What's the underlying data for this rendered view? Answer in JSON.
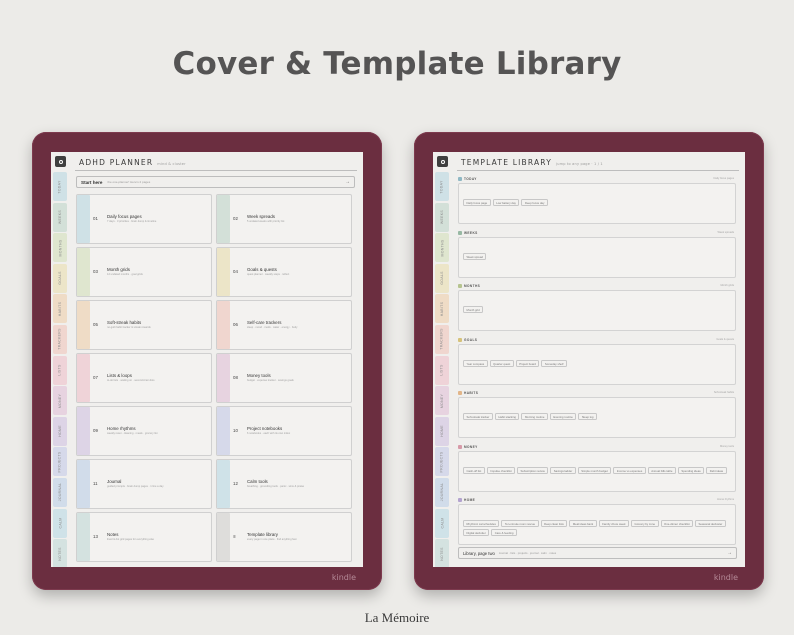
{
  "headline": "Cover & Template Library",
  "brand": "La Mémoire",
  "device_label": "kindle",
  "colors": {
    "device_frame": "#6b2e40",
    "screen": "#f0efed",
    "headline": "#555454"
  },
  "left_screen": {
    "title": "ADHD PLANNER",
    "subtitle": "mind & cluster",
    "start_label": "Start here",
    "start_hint": "the one-planner! Here's 2 pages",
    "start_arrow": "→",
    "sidebar_tabs": [
      {
        "label": "TODAY",
        "color": "#cfe1e6"
      },
      {
        "label": "WEEKS",
        "color": "#d3e0d8"
      },
      {
        "label": "MONTHS",
        "color": "#dfe6cf"
      },
      {
        "label": "GOALS",
        "color": "#ece5c8"
      },
      {
        "label": "HABITS",
        "color": "#efdcc6"
      },
      {
        "label": "TRACKERS",
        "color": "#f0d6cf"
      },
      {
        "label": "LISTS",
        "color": "#efd3d8"
      },
      {
        "label": "MONEY",
        "color": "#e7d3e0"
      },
      {
        "label": "HOME",
        "color": "#ddd4e6"
      },
      {
        "label": "PROJECTS",
        "color": "#d6d9ea"
      },
      {
        "label": "JOURNAL",
        "color": "#d1dcea"
      },
      {
        "label": "CALM",
        "color": "#cfe2e8"
      },
      {
        "label": "NOTES",
        "color": "#d4e2e0"
      }
    ],
    "cards": [
      {
        "num": "01",
        "title": "Daily focus pages",
        "desc": "7 days · 3 priorities · brain dump & timeline",
        "color": "#cfe1e6"
      },
      {
        "num": "02",
        "title": "Week spreads",
        "desc": "5 undated weeks with priority list",
        "color": "#d3e0d8"
      },
      {
        "num": "03",
        "title": "Month grids",
        "desc": "12 undated months · goal grids",
        "color": "#dfe6cf"
      },
      {
        "num": "04",
        "title": "Goals & quests",
        "desc": "quest planner · weekly steps · reflect",
        "color": "#ece5c8"
      },
      {
        "num": "05",
        "title": "Soft-streak habits",
        "desc": "no-guilt habit tracker & streak rewards",
        "color": "#efdcc6"
      },
      {
        "num": "06",
        "title": "Self-care trackers",
        "desc": "sleep · mood · meds · water · energy · body",
        "color": "#f0d6cf"
      },
      {
        "num": "07",
        "title": "Lists & loops",
        "desc": "to-do lists · waiting on · second-brain lists",
        "color": "#efd3d8"
      },
      {
        "num": "08",
        "title": "Money tools",
        "desc": "budget · expense tracker · savings goals",
        "color": "#e7d3e0"
      },
      {
        "num": "09",
        "title": "Home rhythms",
        "desc": "weekly reset · cleaning · meals · grocery list",
        "color": "#ddd4e6"
      },
      {
        "num": "10",
        "title": "Project notebooks",
        "desc": "6 notebooks · each with its own index",
        "color": "#d6d9ea"
      },
      {
        "num": "11",
        "title": "Journal",
        "desc": "guided prompts · brain dump pages · 1 line a day",
        "color": "#d1dcea"
      },
      {
        "num": "12",
        "title": "Calm tools",
        "desc": "breathing · grounding tools · panic · wins & praise",
        "color": "#cfe2e8"
      },
      {
        "num": "13",
        "title": "Notes",
        "desc": "lined & dot grid pages for everything else",
        "color": "#d4e2e0"
      },
      {
        "num": "≡",
        "title": "Template library",
        "desc": "every page in one place · find anything fast",
        "color": "#dedddb"
      }
    ]
  },
  "right_screen": {
    "title": "TEMPLATE LIBRARY",
    "subtitle": "jump to any page · 1 / 1",
    "sidebar_tabs": [
      {
        "label": "TODAY",
        "color": "#cfe1e6"
      },
      {
        "label": "WEEKS",
        "color": "#d3e0d8"
      },
      {
        "label": "MONTHS",
        "color": "#dfe6cf"
      },
      {
        "label": "GOALS",
        "color": "#ece5c8"
      },
      {
        "label": "HABITS",
        "color": "#efdcc6"
      },
      {
        "label": "TRACKERS",
        "color": "#f0d6cf"
      },
      {
        "label": "LISTS",
        "color": "#efd3d8"
      },
      {
        "label": "MONEY",
        "color": "#e7d3e0"
      },
      {
        "label": "HOME",
        "color": "#ddd4e6"
      },
      {
        "label": "PROJECTS",
        "color": "#d6d9ea"
      },
      {
        "label": "JOURNAL",
        "color": "#d1dcea"
      },
      {
        "label": "CALM",
        "color": "#cfe2e8"
      },
      {
        "label": "NOTES",
        "color": "#d4e2e0"
      }
    ],
    "sections": [
      {
        "name": "TODAY",
        "meta": "Daily focus pages",
        "color": "#8fb8c4",
        "chips": [
          "Daily focus page",
          "Low battery day",
          "Deep focus day"
        ]
      },
      {
        "name": "WEEKS",
        "meta": "Week spreads",
        "color": "#97b8a3",
        "chips": [
          "Week spread"
        ]
      },
      {
        "name": "MONTHS",
        "meta": "Month grids",
        "color": "#b6c48f",
        "chips": [
          "Month grid"
        ]
      },
      {
        "name": "GOALS",
        "meta": "Goals & quests",
        "color": "#d6c27a",
        "chips": [
          "Year compass",
          "Quarter quest",
          "Project board",
          "Someday shelf"
        ]
      },
      {
        "name": "HABITS",
        "meta": "Soft-streak habits",
        "color": "#e2b588",
        "chips": [
          "Soft-streak tracker",
          "Habit stacking",
          "Morning routine",
          "Evening routine",
          "Sleep log"
        ]
      },
      {
        "name": "MONEY",
        "meta": "Money tools",
        "color": "#d79aa8",
        "chips": [
          "Cash-off list",
          "Impulse checklist",
          "Subscription review",
          "Savings ladder",
          "Simple month budget",
          "Income vs expenses",
          "Annual bills table",
          "Spending ideas",
          "Debt ideas"
        ]
      },
      {
        "name": "HOME",
        "meta": "Home rhythms",
        "color": "#b3a3cf",
        "chips": [
          "Rhythmic cal schedules",
          "Ten-minute room rescue",
          "Deep clean lists",
          "Meal ideas bank",
          "Family chore week",
          "Grocery by zone",
          "One-dinner checklist",
          "Seasonal decluster",
          "Digital declutter",
          "Care & feeding"
        ]
      }
    ],
    "bottom_label": "Library, page two",
    "bottom_hint": "Journal · lists · projects · journal · calm · notes",
    "bottom_arrow": "→"
  }
}
